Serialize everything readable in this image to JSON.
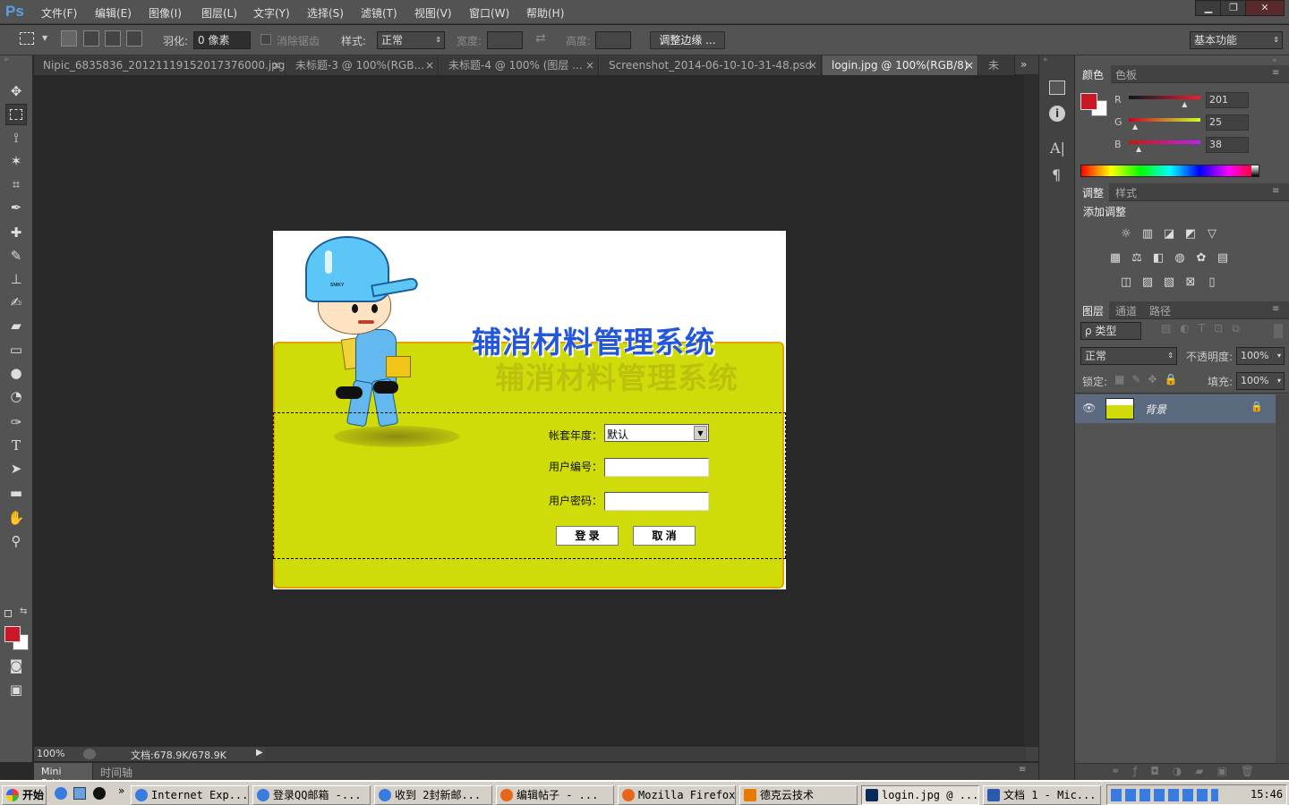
{
  "app": {
    "logo": "Ps"
  },
  "menu": [
    "文件(F)",
    "编辑(E)",
    "图像(I)",
    "图层(L)",
    "文字(Y)",
    "选择(S)",
    "滤镜(T)",
    "视图(V)",
    "窗口(W)",
    "帮助(H)"
  ],
  "window_controls": {
    "minimize": "▁",
    "restore": "❐",
    "close": "✕"
  },
  "options": {
    "feather_label": "羽化:",
    "feather_value": "0 像素",
    "antialias_label": "消除锯齿",
    "style_label": "样式:",
    "style_value": "正常",
    "width_label": "宽度:",
    "height_label": "高度:",
    "refine_edge": "调整边缘 ...",
    "workspace": "基本功能"
  },
  "tabs": [
    {
      "label": "Nipic_6835836_20121119152017376000.jpg",
      "close": "×"
    },
    {
      "label": "未标题-3 @ 100%(RGB...",
      "close": "×"
    },
    {
      "label": "未标题-4 @ 100% (图层 ...",
      "close": "×"
    },
    {
      "label": "Screenshot_2014-06-10-10-31-48.psd",
      "close": "×"
    },
    {
      "label": "login.jpg @ 100%(RGB/8)",
      "close": "×"
    },
    {
      "label": "未",
      "close": ""
    }
  ],
  "tabs_overflow": "»",
  "document": {
    "title": "辅消材料管理系统",
    "hat_text": "SNIKY",
    "form": {
      "year_label": "帐套年度：",
      "year_value": "默认",
      "user_label": "用户编号：",
      "user_value": "",
      "pass_label": "用户密码：",
      "pass_value": "",
      "login_button": "登  录",
      "cancel_button": "取  消"
    }
  },
  "status": {
    "zoom": "100%",
    "doc_size": "文档:678.9K/678.9K"
  },
  "bottom_tabs": {
    "mini_bridge": "Mini Bridge",
    "timeline": "时间轴"
  },
  "color_panel": {
    "tabs": [
      "颜色",
      "色板"
    ],
    "foreground": "#c91926",
    "background": "#ffffff",
    "r_label": "R",
    "g_label": "G",
    "b_label": "B",
    "r": "201",
    "g": "25",
    "b": "38",
    "r_fraction": 0.79,
    "g_fraction": 0.1,
    "b_fraction": 0.15
  },
  "adjust_panel": {
    "tabs": [
      "调整",
      "样式"
    ],
    "title": "添加调整"
  },
  "layers_panel": {
    "tabs": [
      "图层",
      "通道",
      "路径"
    ],
    "filter": "ρ 类型",
    "blend": "正常",
    "opacity_label": "不透明度:",
    "opacity": "100%",
    "lock_label": "锁定:",
    "fill_label": "填充:",
    "fill": "100%",
    "layer_name": "背景"
  },
  "taskbar": {
    "start": "开始",
    "items": [
      "Internet Exp...",
      "登录QQ邮箱 -...",
      "收到 2封新邮...",
      "编辑帖子 - ...",
      "Mozilla Firefox",
      "德克云技术",
      "login.jpg @ ...",
      "文档 1 - Mic..."
    ],
    "clock": "15:46"
  },
  "colors": {
    "accent": "#cfdc0a",
    "brand_blue": "#2456d8",
    "ps_bg": "#535353"
  }
}
